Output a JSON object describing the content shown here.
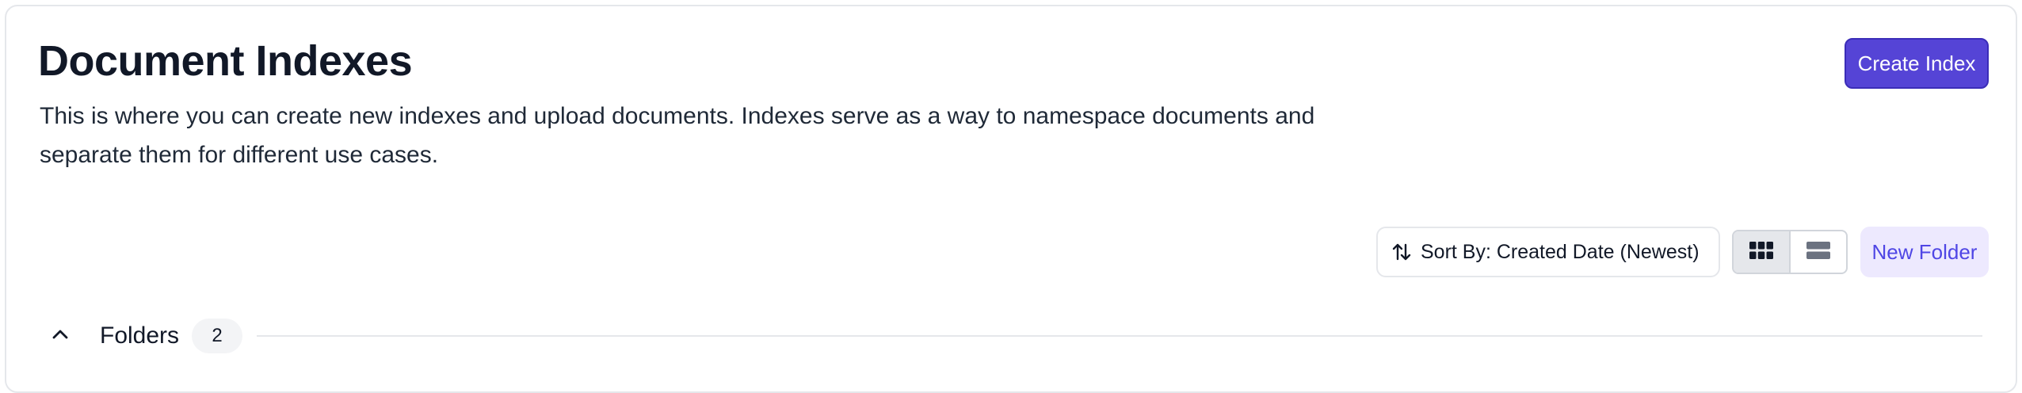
{
  "header": {
    "title": "Document Indexes",
    "description": "This is where you can create new indexes and upload documents. Indexes serve as a way to namespace documents and separate them for different use cases.",
    "create_button_label": "Create Index"
  },
  "toolbar": {
    "sort_label": "Sort By: Created Date (Newest)",
    "sort_icon": "sort-arrows-icon",
    "view_options": [
      {
        "name": "grid",
        "icon": "grid-view-icon",
        "active": true
      },
      {
        "name": "list",
        "icon": "list-view-icon",
        "active": false
      }
    ],
    "new_folder_label": "New Folder"
  },
  "folders_section": {
    "label": "Folders",
    "count": "2",
    "expanded": true,
    "toggle_icon": "chevron-up-icon"
  },
  "colors": {
    "primary": "#5544d6",
    "primary_border": "#3b2db8",
    "secondary_bg": "#ede9fe",
    "secondary_text": "#4f46e5",
    "border": "#e5e7eb"
  }
}
